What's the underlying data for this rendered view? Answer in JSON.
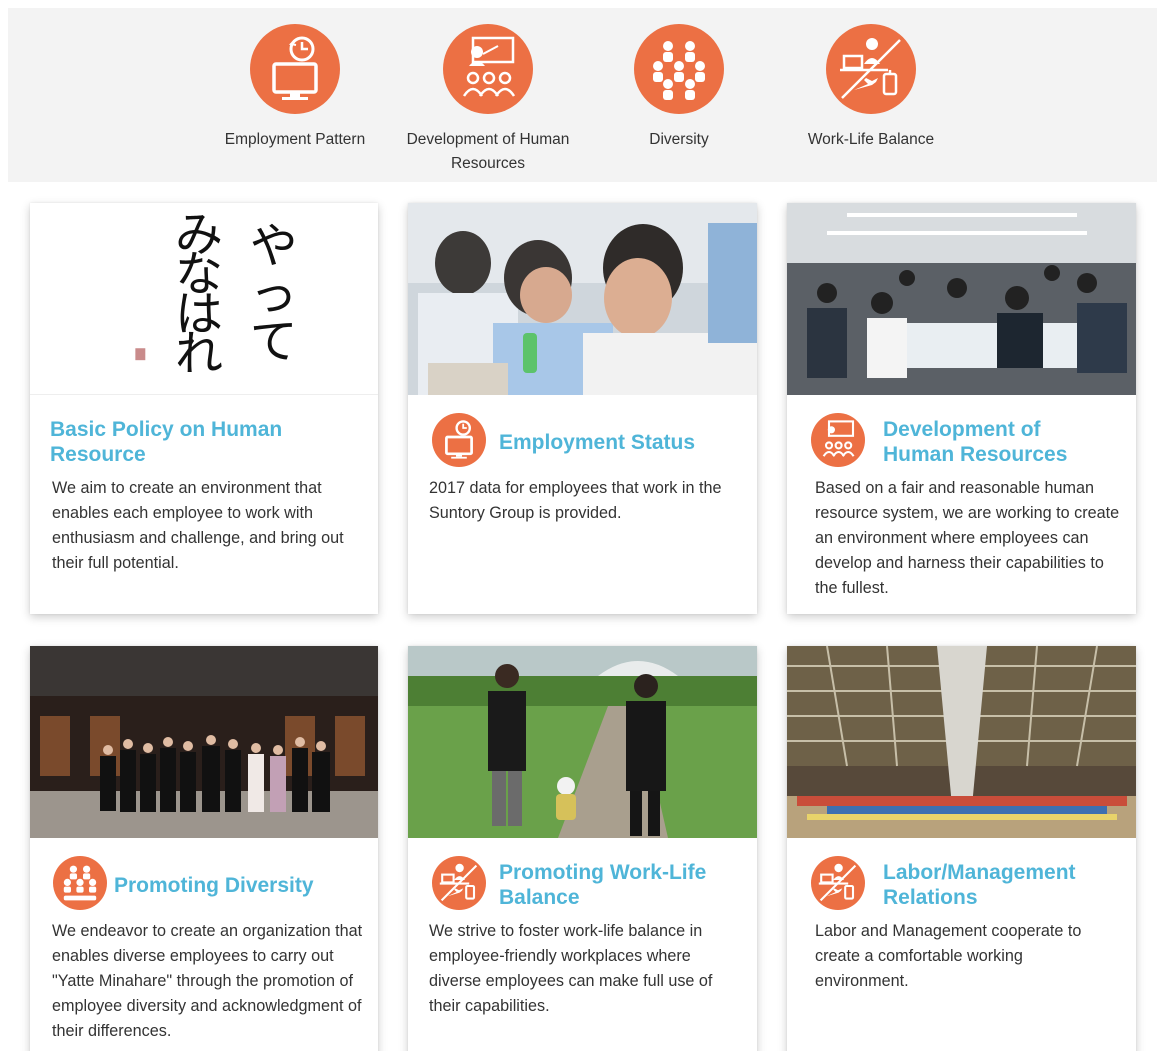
{
  "nav": [
    {
      "label": "Employment Pattern",
      "icon": "clock-monitor-icon"
    },
    {
      "label": "Development of Human Resources",
      "icon": "teacher-group-icon"
    },
    {
      "label": "Diversity",
      "icon": "people-group-icon"
    },
    {
      "label": "Work-Life Balance",
      "icon": "desk-travel-icon"
    }
  ],
  "cards": [
    {
      "title": "Basic Policy on Human Resource",
      "icon": "",
      "image": "yatte-minahare-calligraphy",
      "calligraphy": "やってみなはれ",
      "desc": "We aim to create an environment that enables each employee to work with enthusiasm and challenge, and bring out their full potential."
    },
    {
      "title": "Employment Status",
      "icon": "clock-monitor-icon",
      "image": "employees-in-meeting-photo",
      "desc": "2017 data for employees that work in the Suntory Group is provided."
    },
    {
      "title": "Development of Human Resources",
      "icon": "teacher-group-icon",
      "image": "training-session-photo",
      "desc": "Based on a fair and reasonable human resource system, we are working to create an environment where employees can develop and harness their capabilities to the fullest."
    },
    {
      "title": "Promoting Diversity",
      "icon": "people-group-icon",
      "image": "group-photo-outside-building",
      "desc": "We endeavor to create an organization that enables diverse employees to carry out \"Yatte Minahare\" through the promotion of employee diversity and acknowledgment of their differences."
    },
    {
      "title": "Promoting Work-Life Balance",
      "icon": "desk-travel-icon",
      "image": "family-in-park-photo",
      "desc": "We strive to foster work-life balance in employee-friendly workplaces where diverse employees can make full use of their capabilities."
    },
    {
      "title": "Labor/Management Relations",
      "icon": "desk-travel-icon",
      "image": "large-hall-gathering-photo",
      "desc": "Labor and Management cooperate to create a comfortable working environment."
    }
  ],
  "colors": {
    "accent": "#ec7044",
    "title": "#4fb5d8",
    "nav_bg": "#f3f3f3"
  }
}
